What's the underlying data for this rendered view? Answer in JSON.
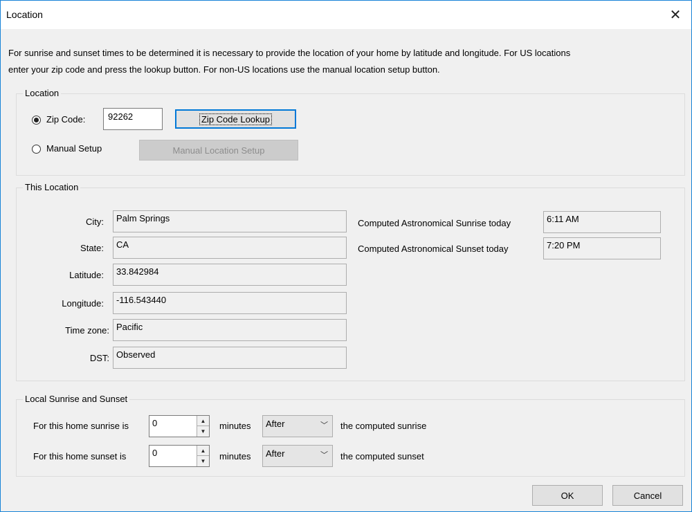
{
  "window": {
    "title": "Location",
    "close_glyph": "✕"
  },
  "intro": {
    "line1": "For sunrise and sunset times to be determined it is necessary to provide the location of your home by latitude and longitude.  For US locations",
    "line2": "enter your zip code and press the lookup button.  For non-US locations use the manual location setup button."
  },
  "location_group": {
    "label": "Location",
    "zip_radio_label": "Zip Code:",
    "zip_value": "92262",
    "zip_lookup_button": "Zip Code Lookup",
    "manual_radio_label": "Manual Setup",
    "manual_button": "Manual Location Setup",
    "selected": "zip"
  },
  "this_location": {
    "label": "This Location",
    "fields": [
      {
        "label": "City:",
        "value": "Palm Springs"
      },
      {
        "label": "State:",
        "value": "CA"
      },
      {
        "label": "Latitude:",
        "value": "33.842984"
      },
      {
        "label": "Longitude:",
        "value": "-116.543440"
      },
      {
        "label": "Time zone:",
        "value": "Pacific"
      },
      {
        "label": "DST:",
        "value": "Observed"
      }
    ],
    "sunrise_label": "Computed Astronomical Sunrise today",
    "sunrise_value": "6:11 AM",
    "sunset_label": "Computed Astronomical Sunset today",
    "sunset_value": "7:20 PM"
  },
  "local_group": {
    "label": "Local Sunrise and Sunset",
    "sunrise_row": {
      "prefix": "For this home sunrise is",
      "value": "0",
      "unit": "minutes",
      "direction": "After",
      "suffix": "the computed sunrise"
    },
    "sunset_row": {
      "prefix": "For this home sunset is",
      "value": "0",
      "unit": "minutes",
      "direction": "After",
      "suffix": "the computed sunset"
    }
  },
  "footer": {
    "ok": "OK",
    "cancel": "Cancel"
  },
  "icons": {
    "spin_up": "▲",
    "spin_down": "▼",
    "dropdown": "﹀"
  },
  "colors": {
    "accent": "#0078d7",
    "border": "#1883d7",
    "background": "#f0f0f0"
  }
}
